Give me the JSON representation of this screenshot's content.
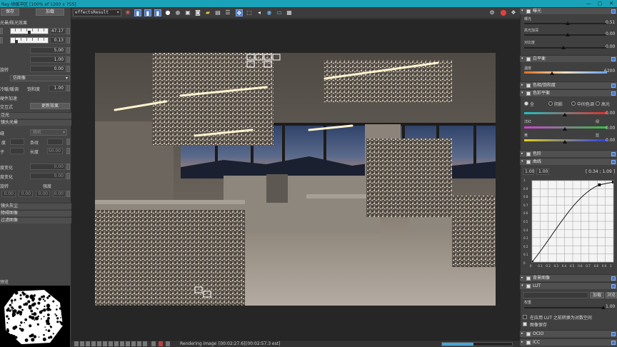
{
  "window": {
    "title": "Ray 帧缓冲区 [100% of 1200 x 755]",
    "minimize": "—",
    "maximize": "▢",
    "close": "✕"
  },
  "left_panel": {
    "save_label": "保存",
    "load_label": "加载",
    "lens_effects_label": "光晕/眩光效果",
    "slider1_value": "47.17",
    "slider2_value": "0.13",
    "val_a": "5.00",
    "val_b": "1.00",
    "rotation_label": "旋转",
    "rotation_value": "0.00",
    "shape_dropdown": "仿图像",
    "tint_label": "冷暖/暖调",
    "saturation_label": "饱和度",
    "saturation_value": "1.00",
    "hardware_accel_label": "硬件加速",
    "interactive_label": "交互式",
    "update_effect_label": "更新效果",
    "bloom_label": "泛光",
    "lens_glare_label": "镜头光晕",
    "type_dropdown": "随机",
    "x_label": "缝",
    "strips_label": "条纹",
    "strips_value": "",
    "degree_label": "度",
    "length_label": "长度",
    "length_value": "50.00",
    "sub_label": "子",
    "var1_label": "度变化",
    "var1_value": "0.00",
    "var2_label": "度变化",
    "var2_value": "0.00",
    "rotate_label": "旋转",
    "intensity_label": "强度",
    "rot_a": "0.00",
    "rot_b": "0.00",
    "rot_c": "0.00",
    "rot_d": "0.00",
    "lens_dust_label": "镜头灰尘",
    "obstacle_label": "障碍图像",
    "filter_label": "过滤图像",
    "preview_label": "预览"
  },
  "toolbar": {
    "channel_dropdown": "effectsResult",
    "icons": [
      "color-wheel-icon",
      "red-channel-icon",
      "green-channel-icon",
      "blue-channel-icon",
      "white-circle-icon",
      "gray-circle-icon",
      "save-image-icon",
      "camera-icon",
      "folder-icon",
      "clear-icon",
      "history-icon",
      "compare-icon",
      "cursor-icon",
      "region-icon",
      "back-icon",
      "lens-icon",
      "monitor-icon",
      "render-icon"
    ],
    "right_icons": [
      "gear-icon",
      "stop-icon",
      "render-interactive-icon"
    ]
  },
  "status": {
    "status_text": "Rendering image",
    "elapsed": "[00:02:27.6]",
    "remaining": "[00:02:57.3 est]",
    "progress": 0.45
  },
  "right_panel": {
    "exposure_label": "曝光",
    "exposure_sub": "曝光",
    "exposure_value": "0.51",
    "highlight_label": "高光加深",
    "highlight_value": "0.00",
    "contrast_label": "对比度",
    "contrast_value": "0.00",
    "white_balance_label": "白平衡",
    "temperature_label": "温度",
    "temperature_value": "6200",
    "hue_sat_label": "色相/饱和度",
    "color_balance_label": "色彩平衡",
    "all_label": "全",
    "shadows_label": "阴影",
    "midtones_label": "中间色调",
    "highlights_label": "高光",
    "cb1_value": "0.00",
    "cb2_left": "洋红",
    "cb2_right": "绿",
    "cb2_value": "0.00",
    "cb3_left": "黄",
    "cb3_right": "蓝",
    "cb3_value": "0.00",
    "levels_label": "色阶",
    "curves_label": "曲线",
    "curve_in": "1.00",
    "curve_out": "1.00",
    "curve_readout": "[ 0.34 ; 1.09 ]",
    "curve_y_ticks": [
      "1",
      "0.9",
      "0.8",
      "0.7",
      "0.6",
      "0.5",
      "0.4",
      "0.3",
      "0.2",
      "0.1",
      "0"
    ],
    "curve_x_ticks": [
      "0",
      "0.1",
      "0.2",
      "0.3",
      "0.4",
      "0.5",
      "0.6",
      "0.7",
      "0.8",
      "0.9",
      "1"
    ],
    "background_label": "背景图像",
    "lut_label": "LUT",
    "lut_load": "加载",
    "lut_browse": "浏览",
    "weight_label": "权重",
    "weight_value": "1.00",
    "convert_log_label": "在应用 LUT 之前转换为对数空间",
    "save_image_label": "图像保存",
    "ocio_label": "OCIO",
    "icc_label": "ICC"
  },
  "colors": {
    "titlebar": "#1aa3b8",
    "accent": "#4a78c0",
    "progress": "#49a3d6"
  }
}
